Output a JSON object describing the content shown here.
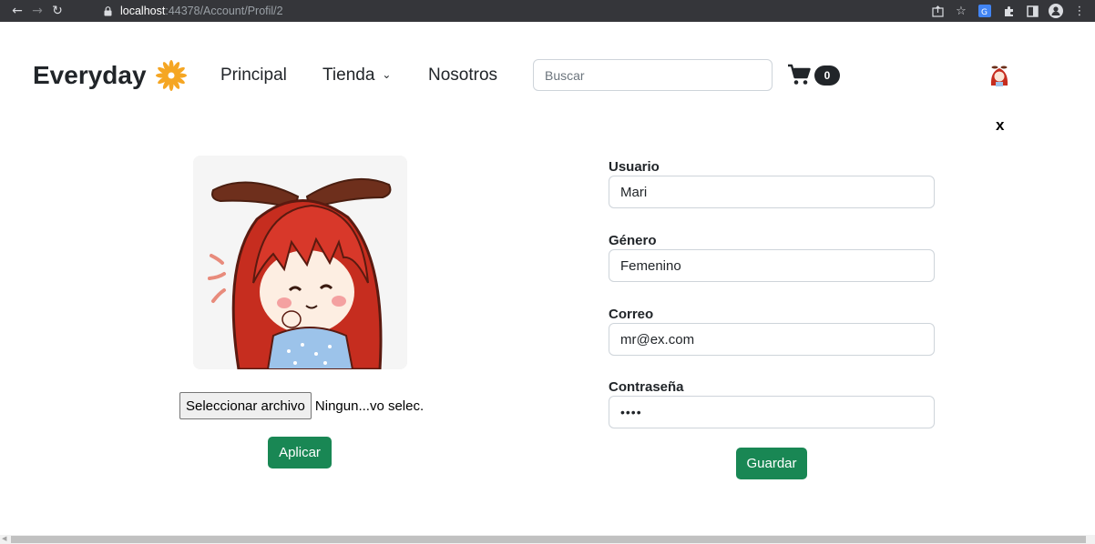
{
  "browser": {
    "url_host": "localhost",
    "url_path": ":44378/Account/Profil/2"
  },
  "navbar": {
    "brand": "Everyday",
    "links": [
      "Principal",
      "Tienda",
      "Nosotros"
    ],
    "search_placeholder": "Buscar",
    "cart_count": "0"
  },
  "close_label": "x",
  "profile": {
    "file_button": "Seleccionar archivo",
    "file_name": "Ningun...vo selec.",
    "apply_button": "Aplicar"
  },
  "form": {
    "fields": [
      {
        "label": "Usuario",
        "value": "Mari"
      },
      {
        "label": "Género",
        "value": "Femenino"
      },
      {
        "label": "Correo",
        "value": "mr@ex.com"
      },
      {
        "label": "Contraseña",
        "value": "••••"
      }
    ],
    "save_button": "Guardar"
  },
  "colors": {
    "primary_button": "#198754",
    "chrome_bar": "#35363a"
  }
}
